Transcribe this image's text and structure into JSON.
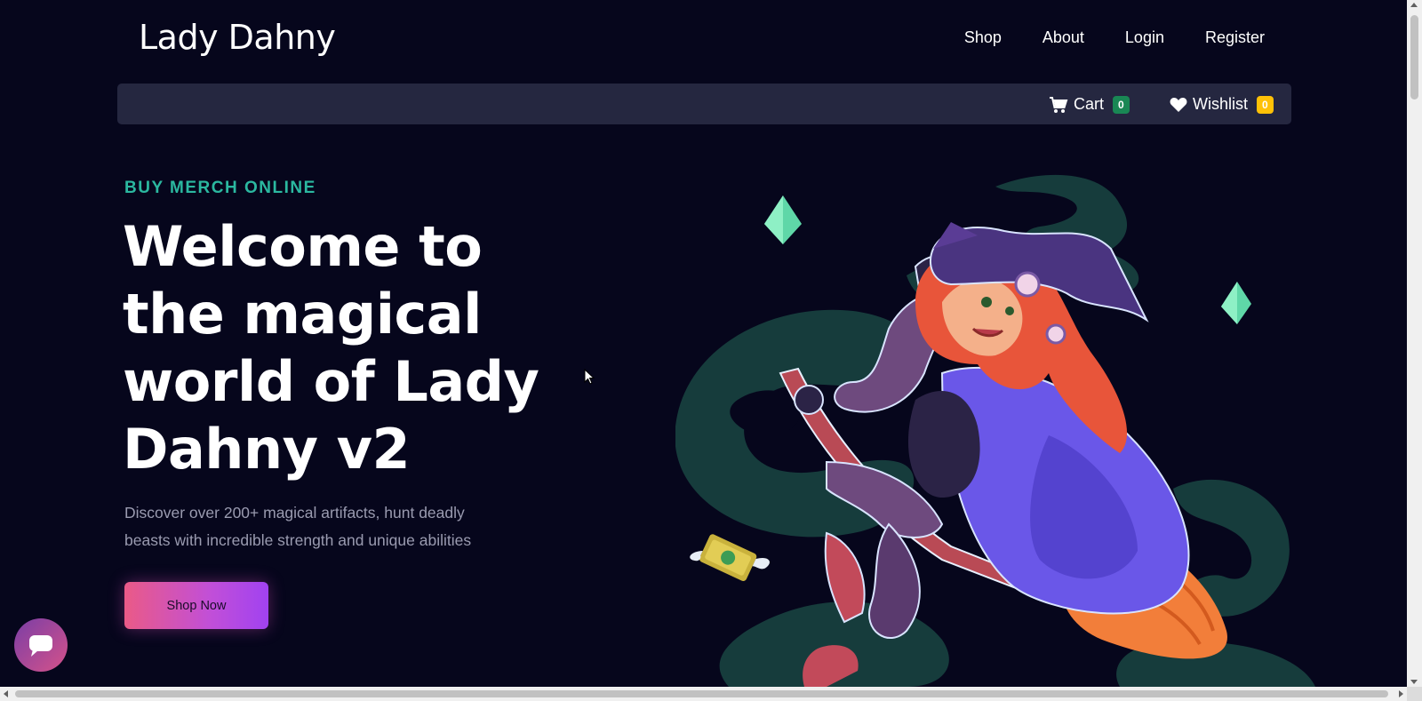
{
  "header": {
    "brand": "Lady Dahny",
    "nav": [
      {
        "label": "Shop"
      },
      {
        "label": "About"
      },
      {
        "label": "Login"
      },
      {
        "label": "Register"
      }
    ]
  },
  "subbar": {
    "cart": {
      "label": "Cart",
      "count": "0",
      "icon": "cart-icon",
      "badge_color": "#198754"
    },
    "wishlist": {
      "label": "Wishlist",
      "count": "0",
      "icon": "heart-icon",
      "badge_color": "#ffc107"
    }
  },
  "hero": {
    "eyebrow": "BUY MERCH ONLINE",
    "headline": "Welcome to the magical world of Lady Dahny v2",
    "lede": "Discover over 200+ magical artifacts, hunt deadly beasts with incredible strength and unique abilities",
    "cta": "Shop Now",
    "illustration": "witch-on-broom-illustration"
  },
  "chat": {
    "icon": "chat-bubble-icon"
  },
  "colors": {
    "background": "#06061c",
    "subbar": "#252740",
    "eyebrow": "#2bb8a0",
    "cta_start": "#ea5a87",
    "cta_end": "#a142f0"
  }
}
